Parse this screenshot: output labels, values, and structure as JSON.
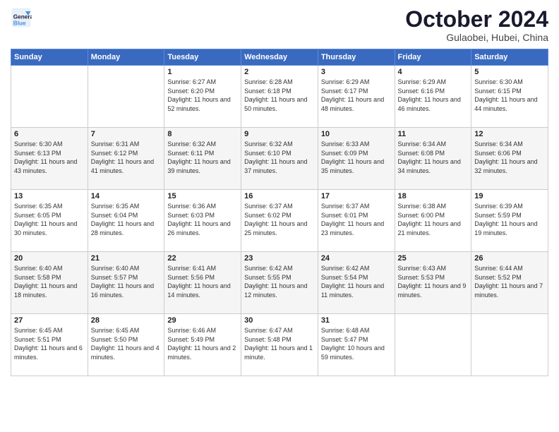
{
  "header": {
    "logo_line1": "General",
    "logo_line2": "Blue",
    "month": "October 2024",
    "location": "Gulaobei, Hubei, China"
  },
  "weekdays": [
    "Sunday",
    "Monday",
    "Tuesday",
    "Wednesday",
    "Thursday",
    "Friday",
    "Saturday"
  ],
  "weeks": [
    [
      {
        "day": "",
        "sunrise": "",
        "sunset": "",
        "daylight": ""
      },
      {
        "day": "",
        "sunrise": "",
        "sunset": "",
        "daylight": ""
      },
      {
        "day": "1",
        "sunrise": "Sunrise: 6:27 AM",
        "sunset": "Sunset: 6:20 PM",
        "daylight": "Daylight: 11 hours and 52 minutes."
      },
      {
        "day": "2",
        "sunrise": "Sunrise: 6:28 AM",
        "sunset": "Sunset: 6:18 PM",
        "daylight": "Daylight: 11 hours and 50 minutes."
      },
      {
        "day": "3",
        "sunrise": "Sunrise: 6:29 AM",
        "sunset": "Sunset: 6:17 PM",
        "daylight": "Daylight: 11 hours and 48 minutes."
      },
      {
        "day": "4",
        "sunrise": "Sunrise: 6:29 AM",
        "sunset": "Sunset: 6:16 PM",
        "daylight": "Daylight: 11 hours and 46 minutes."
      },
      {
        "day": "5",
        "sunrise": "Sunrise: 6:30 AM",
        "sunset": "Sunset: 6:15 PM",
        "daylight": "Daylight: 11 hours and 44 minutes."
      }
    ],
    [
      {
        "day": "6",
        "sunrise": "Sunrise: 6:30 AM",
        "sunset": "Sunset: 6:13 PM",
        "daylight": "Daylight: 11 hours and 43 minutes."
      },
      {
        "day": "7",
        "sunrise": "Sunrise: 6:31 AM",
        "sunset": "Sunset: 6:12 PM",
        "daylight": "Daylight: 11 hours and 41 minutes."
      },
      {
        "day": "8",
        "sunrise": "Sunrise: 6:32 AM",
        "sunset": "Sunset: 6:11 PM",
        "daylight": "Daylight: 11 hours and 39 minutes."
      },
      {
        "day": "9",
        "sunrise": "Sunrise: 6:32 AM",
        "sunset": "Sunset: 6:10 PM",
        "daylight": "Daylight: 11 hours and 37 minutes."
      },
      {
        "day": "10",
        "sunrise": "Sunrise: 6:33 AM",
        "sunset": "Sunset: 6:09 PM",
        "daylight": "Daylight: 11 hours and 35 minutes."
      },
      {
        "day": "11",
        "sunrise": "Sunrise: 6:34 AM",
        "sunset": "Sunset: 6:08 PM",
        "daylight": "Daylight: 11 hours and 34 minutes."
      },
      {
        "day": "12",
        "sunrise": "Sunrise: 6:34 AM",
        "sunset": "Sunset: 6:06 PM",
        "daylight": "Daylight: 11 hours and 32 minutes."
      }
    ],
    [
      {
        "day": "13",
        "sunrise": "Sunrise: 6:35 AM",
        "sunset": "Sunset: 6:05 PM",
        "daylight": "Daylight: 11 hours and 30 minutes."
      },
      {
        "day": "14",
        "sunrise": "Sunrise: 6:35 AM",
        "sunset": "Sunset: 6:04 PM",
        "daylight": "Daylight: 11 hours and 28 minutes."
      },
      {
        "day": "15",
        "sunrise": "Sunrise: 6:36 AM",
        "sunset": "Sunset: 6:03 PM",
        "daylight": "Daylight: 11 hours and 26 minutes."
      },
      {
        "day": "16",
        "sunrise": "Sunrise: 6:37 AM",
        "sunset": "Sunset: 6:02 PM",
        "daylight": "Daylight: 11 hours and 25 minutes."
      },
      {
        "day": "17",
        "sunrise": "Sunrise: 6:37 AM",
        "sunset": "Sunset: 6:01 PM",
        "daylight": "Daylight: 11 hours and 23 minutes."
      },
      {
        "day": "18",
        "sunrise": "Sunrise: 6:38 AM",
        "sunset": "Sunset: 6:00 PM",
        "daylight": "Daylight: 11 hours and 21 minutes."
      },
      {
        "day": "19",
        "sunrise": "Sunrise: 6:39 AM",
        "sunset": "Sunset: 5:59 PM",
        "daylight": "Daylight: 11 hours and 19 minutes."
      }
    ],
    [
      {
        "day": "20",
        "sunrise": "Sunrise: 6:40 AM",
        "sunset": "Sunset: 5:58 PM",
        "daylight": "Daylight: 11 hours and 18 minutes."
      },
      {
        "day": "21",
        "sunrise": "Sunrise: 6:40 AM",
        "sunset": "Sunset: 5:57 PM",
        "daylight": "Daylight: 11 hours and 16 minutes."
      },
      {
        "day": "22",
        "sunrise": "Sunrise: 6:41 AM",
        "sunset": "Sunset: 5:56 PM",
        "daylight": "Daylight: 11 hours and 14 minutes."
      },
      {
        "day": "23",
        "sunrise": "Sunrise: 6:42 AM",
        "sunset": "Sunset: 5:55 PM",
        "daylight": "Daylight: 11 hours and 12 minutes."
      },
      {
        "day": "24",
        "sunrise": "Sunrise: 6:42 AM",
        "sunset": "Sunset: 5:54 PM",
        "daylight": "Daylight: 11 hours and 11 minutes."
      },
      {
        "day": "25",
        "sunrise": "Sunrise: 6:43 AM",
        "sunset": "Sunset: 5:53 PM",
        "daylight": "Daylight: 11 hours and 9 minutes."
      },
      {
        "day": "26",
        "sunrise": "Sunrise: 6:44 AM",
        "sunset": "Sunset: 5:52 PM",
        "daylight": "Daylight: 11 hours and 7 minutes."
      }
    ],
    [
      {
        "day": "27",
        "sunrise": "Sunrise: 6:45 AM",
        "sunset": "Sunset: 5:51 PM",
        "daylight": "Daylight: 11 hours and 6 minutes."
      },
      {
        "day": "28",
        "sunrise": "Sunrise: 6:45 AM",
        "sunset": "Sunset: 5:50 PM",
        "daylight": "Daylight: 11 hours and 4 minutes."
      },
      {
        "day": "29",
        "sunrise": "Sunrise: 6:46 AM",
        "sunset": "Sunset: 5:49 PM",
        "daylight": "Daylight: 11 hours and 2 minutes."
      },
      {
        "day": "30",
        "sunrise": "Sunrise: 6:47 AM",
        "sunset": "Sunset: 5:48 PM",
        "daylight": "Daylight: 11 hours and 1 minute."
      },
      {
        "day": "31",
        "sunrise": "Sunrise: 6:48 AM",
        "sunset": "Sunset: 5:47 PM",
        "daylight": "Daylight: 10 hours and 59 minutes."
      },
      {
        "day": "",
        "sunrise": "",
        "sunset": "",
        "daylight": ""
      },
      {
        "day": "",
        "sunrise": "",
        "sunset": "",
        "daylight": ""
      }
    ]
  ]
}
